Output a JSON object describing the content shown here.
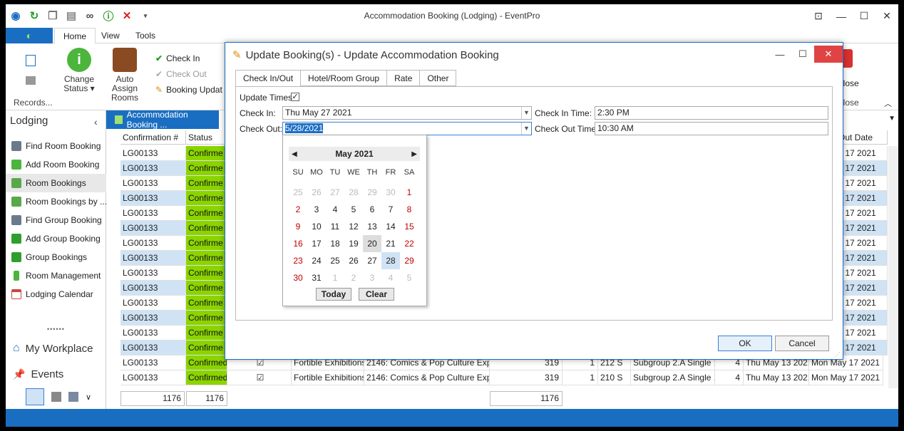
{
  "app": {
    "title": "Accommodation Booking (Lodging) - EventPro"
  },
  "ribbon": {
    "tabs": [
      {
        "label": "Home"
      },
      {
        "label": "View"
      },
      {
        "label": "Tools"
      }
    ],
    "records_label": "Records...",
    "change_status": "Change Status ▾",
    "auto_assign": "Auto Assign Rooms",
    "check_in": "Check In",
    "check_out": "Check Out",
    "booking_update": "Booking Updat",
    "close": "Close",
    "close_group": "Close"
  },
  "sidebar": {
    "title": "Lodging",
    "items": [
      {
        "label": "Find Room Booking",
        "icon": "binoculars-icon"
      },
      {
        "label": "Add Room Booking",
        "icon": "add-booking-icon"
      },
      {
        "label": "Room Bookings",
        "icon": "bookings-icon"
      },
      {
        "label": "Room Bookings by ...",
        "icon": "bookings-icon"
      },
      {
        "label": "Find Group Booking",
        "icon": "binoculars-icon"
      },
      {
        "label": "Add Group Booking",
        "icon": "add-group-icon"
      },
      {
        "label": "Group Bookings",
        "icon": "group-icon"
      },
      {
        "label": "Room Management",
        "icon": "room-icon"
      },
      {
        "label": "Lodging Calendar",
        "icon": "calendar-icon"
      }
    ],
    "my_workplace": "My Workplace",
    "events": "Events"
  },
  "grid": {
    "tab_label": "Accommodation Booking ...",
    "headers": [
      "Confirmation #",
      "Status"
    ],
    "out_date_header": "Out Date",
    "rows": [
      {
        "id": "LG00133",
        "status": "Confirme",
        "out": "y 17 2021"
      },
      {
        "id": "LG00133",
        "status": "Confirme",
        "out": "y 17 2021"
      },
      {
        "id": "LG00133",
        "status": "Confirme",
        "out": "y 17 2021"
      },
      {
        "id": "LG00133",
        "status": "Confirme",
        "out": "y 17 2021"
      },
      {
        "id": "LG00133",
        "status": "Confirme",
        "out": "y 17 2021"
      },
      {
        "id": "LG00133",
        "status": "Confirme",
        "out": "y 17 2021"
      },
      {
        "id": "LG00133",
        "status": "Confirme",
        "out": "y 17 2021"
      },
      {
        "id": "LG00133",
        "status": "Confirme",
        "out": "y 17 2021"
      },
      {
        "id": "LG00133",
        "status": "Confirme",
        "out": "y 17 2021"
      },
      {
        "id": "LG00133",
        "status": "Confirme",
        "out": "y 17 2021"
      },
      {
        "id": "LG00133",
        "status": "Confirme",
        "out": "y 17 2021"
      },
      {
        "id": "LG00133",
        "status": "Confirme",
        "out": "y 17 2021"
      },
      {
        "id": "LG00133",
        "status": "Confirme",
        "out": "y 17 2021"
      },
      {
        "id": "LG00133",
        "status": "Confirme",
        "out": "y 17 2021"
      }
    ],
    "row15": {
      "id": "LG00133",
      "status": "Confirmed",
      "company": "Fortible Exhibitions",
      "event": "2146: Comics & Pop Culture Expo",
      "num": "319",
      "qty": "1",
      "room": "212 S",
      "group": "Subgroup 2.A Single 1",
      "n": "4",
      "in": "Thu May 13 2021",
      "out": "Mon May 17 2021"
    },
    "row16": {
      "id": "LG00133",
      "status": "Confirmed",
      "company": "Fortible Exhibitions",
      "event": "2146: Comics & Pop Culture Expo",
      "num": "319",
      "qty": "1",
      "room": "210 S",
      "group": "Subgroup 2.A Single 1",
      "n": "4",
      "in": "Thu May 13 2021",
      "out": "Mon May 17 2021"
    },
    "footer": {
      "c1": "1176",
      "c2": "1176",
      "c3": "1176"
    }
  },
  "dialog": {
    "title": "Update Booking(s) - Update Accommodation Booking",
    "tabs": [
      {
        "label": "Check In/Out"
      },
      {
        "label": "Hotel/Room Group"
      },
      {
        "label": "Rate"
      },
      {
        "label": "Other"
      }
    ],
    "update_times": "Update Times",
    "check_in_label": "Check In:",
    "check_in_value": "Thu May 27 2021",
    "check_out_label": "Check Out:",
    "check_out_value": "5/28/2021",
    "check_in_time_label": "Check In Time:",
    "check_in_time_value": "2:30 PM",
    "check_out_time_label": "Check Out Time:",
    "check_out_time_value": "10:30 AM",
    "ok": "OK",
    "cancel": "Cancel"
  },
  "calendar": {
    "month": "May 2021",
    "dow": [
      "SU",
      "MO",
      "TU",
      "WE",
      "TH",
      "FR",
      "SA"
    ],
    "weeks": [
      [
        "25",
        "26",
        "27",
        "28",
        "29",
        "30",
        "1"
      ],
      [
        "2",
        "3",
        "4",
        "5",
        "6",
        "7",
        "8"
      ],
      [
        "9",
        "10",
        "11",
        "12",
        "13",
        "14",
        "15"
      ],
      [
        "16",
        "17",
        "18",
        "19",
        "20",
        "21",
        "22"
      ],
      [
        "23",
        "24",
        "25",
        "26",
        "27",
        "28",
        "29"
      ],
      [
        "30",
        "31",
        "1",
        "2",
        "3",
        "4",
        "5"
      ]
    ],
    "today": "Today",
    "clear": "Clear"
  }
}
